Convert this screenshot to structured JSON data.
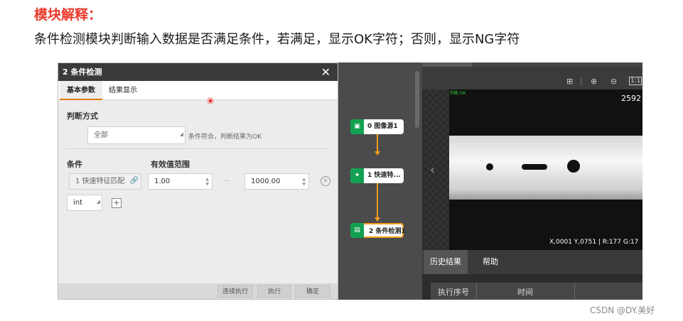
{
  "heading": "模块解释：",
  "description": "条件检测模块判断输入数据是否满足条件，若满足，显示OK字符；否则，显示NG字符",
  "dialog": {
    "title": "2 条件检测",
    "close_icon": "close-icon",
    "tabs": [
      {
        "label": "基本参数",
        "active": true
      },
      {
        "label": "结果显示",
        "active": false
      }
    ],
    "judge_section_label": "判断方式",
    "judge_mode_value": "全部",
    "judge_mode_hint": "条件符合，判断结果为OK",
    "condition_header": "条件",
    "range_header": "有效值范围",
    "condition_input_value": "1 快速特征匹配",
    "link_icon": "link-icon",
    "range_min": "1.00",
    "range_max": "1000.00",
    "range_dash": "—",
    "remove_icon": "remove-circle-icon",
    "type_value": "int",
    "add_icon": "plus-icon",
    "footer_buttons": [
      "连续执行",
      "执行",
      "确定"
    ]
  },
  "flow": {
    "nodes": [
      {
        "label": "0 图像源1",
        "icon": "image-icon"
      },
      {
        "label": "1 快速特...",
        "icon": "feature-match-icon"
      },
      {
        "label": "2 条件检测1",
        "icon": "condition-icon",
        "selected": true
      }
    ]
  },
  "viewer": {
    "status_text": "判断:OK",
    "resolution_text": "2592",
    "coord_readout": "X,0001  Y,0751  |  R:177  G:17",
    "toolbar_icons": [
      "fit-icon",
      "zoom-in-icon",
      "zoom-out-icon",
      "one-to-one-icon"
    ],
    "one_to_one_label": "1:1",
    "prev_icon": "chevron-left-icon",
    "bottom_tabs": [
      {
        "label": "历史结果",
        "active": true
      },
      {
        "label": "帮助",
        "active": false
      }
    ],
    "table_headers": [
      "执行序号",
      "时间"
    ]
  },
  "watermark": "CSDN @DY.美好",
  "colors": {
    "accent_orange": "#f39a1d",
    "node_green": "#12a150",
    "heading_red": "#e8392b",
    "status_green": "#2ecc40"
  }
}
